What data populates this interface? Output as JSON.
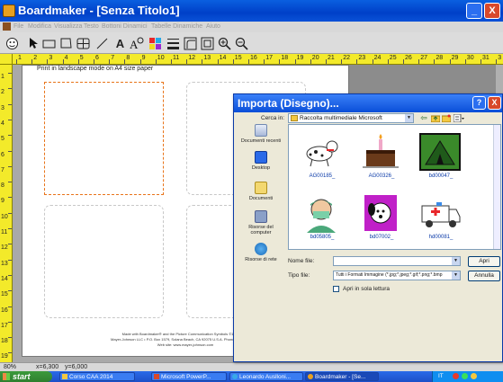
{
  "window": {
    "title": "Boardmaker - [Senza Titolo1]",
    "minimize": "_",
    "close": "X"
  },
  "menu": [
    "File",
    "Modifica",
    "Visualizza",
    "Testo",
    "Bottoni Dinamici",
    "Tabelle Dinamiche",
    "Aiuto"
  ],
  "ruler": {
    "h_numbers": [
      "1",
      "2",
      "3",
      "4",
      "5",
      "6",
      "7",
      "8",
      "9",
      "10",
      "11",
      "12",
      "13",
      "14",
      "15",
      "16",
      "17",
      "18",
      "19",
      "20",
      "21",
      "22",
      "23",
      "24",
      "25",
      "26",
      "27",
      "28",
      "29",
      "30",
      "31",
      "3"
    ],
    "v_numbers": [
      "1",
      "2",
      "3",
      "4",
      "5",
      "6",
      "7",
      "8",
      "9",
      "10",
      "11",
      "12",
      "13",
      "14",
      "15",
      "16",
      "17",
      "18",
      "19"
    ]
  },
  "canvas": {
    "paper_label": "Print in landscape mode on A4 size paper",
    "footer_line1": "Made with Boardmaker® and the Picture Communication Symbols ©1981-2004",
    "footer_line2": "Mayer-Johnson LLC • P.O. Box 1579, Solana Beach, CA 92075 U.S.A. Phone (858) 550-0084",
    "footer_line3": "Web site: www.mayer-johnson.com"
  },
  "status": {
    "zoom": "80%",
    "x": "x=6,300",
    "y": "y=6,000"
  },
  "taskbar": {
    "start": "start",
    "tasks": [
      "Corso CAA 2014",
      "Microsoft PowerP...",
      "Leonardo Auslloni...",
      "Boardmaker - [Se..."
    ],
    "tray_time": "IT"
  },
  "dialog": {
    "title": "Importa (Disegno)...",
    "help": "?",
    "close": "X",
    "look_in_label": "Cerca in:",
    "look_in_value": "Raccolta multimediale Microsoft",
    "places": [
      "Documenti recenti",
      "Desktop",
      "Documenti",
      "Risorse del computer",
      "Risorse di rete"
    ],
    "files": [
      {
        "name": "AG00185_",
        "icon": "dalmatian-dog"
      },
      {
        "name": "AG00326_",
        "icon": "birthday-cake"
      },
      {
        "name": "bd00047_",
        "icon": "green-tent"
      },
      {
        "name": "bd05805_",
        "icon": "surgeon"
      },
      {
        "name": "bd07002_",
        "icon": "puppy-purple"
      },
      {
        "name": "hd00081_",
        "icon": "ambulance"
      }
    ],
    "filename_label": "Nome file:",
    "filename_value": "",
    "filetype_label": "Tipo file:",
    "filetype_value": "Tutti i Formati Immagine (*.jpg;*.jpeg;*.gif;*.png;*.bmp",
    "open_button": "Apri",
    "cancel_button": "Annulla",
    "readonly_label": "Apri in sola lettura"
  }
}
